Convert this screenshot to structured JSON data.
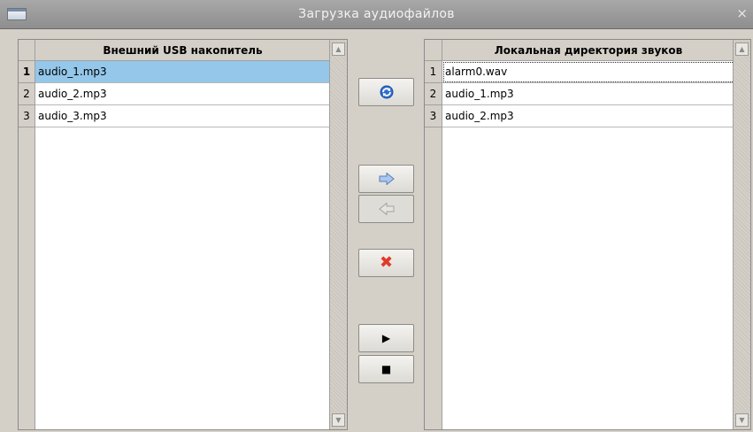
{
  "window": {
    "title": "Загрузка аудиофайлов",
    "close_glyph": "×"
  },
  "usb_table": {
    "header": "Внешний USB накопитель",
    "rows": [
      {
        "num": "1",
        "file": "audio_1.mp3"
      },
      {
        "num": "2",
        "file": "audio_2.mp3"
      },
      {
        "num": "3",
        "file": "audio_3.mp3"
      }
    ],
    "selected_row": 1
  },
  "local_table": {
    "header": "Локальная директория звуков",
    "rows": [
      {
        "num": "1",
        "file": "alarm0.wav"
      },
      {
        "num": "2",
        "file": "audio_1.mp3"
      },
      {
        "num": "3",
        "file": "audio_2.mp3"
      }
    ],
    "focused_row": 1
  },
  "toolbar": {
    "refresh_icon": "refresh-icon",
    "copy_right_icon": "arrow-right-icon",
    "copy_left_icon": "arrow-left-icon",
    "delete_glyph": "✖",
    "play_glyph": "▶",
    "stop_glyph": "■",
    "copy_left_disabled": true
  },
  "colors": {
    "selection": "#94c7e9",
    "delete_red": "#e03a2a",
    "arrow_blue": "#a9c7f0",
    "titlebar": "#9a9a9a"
  }
}
